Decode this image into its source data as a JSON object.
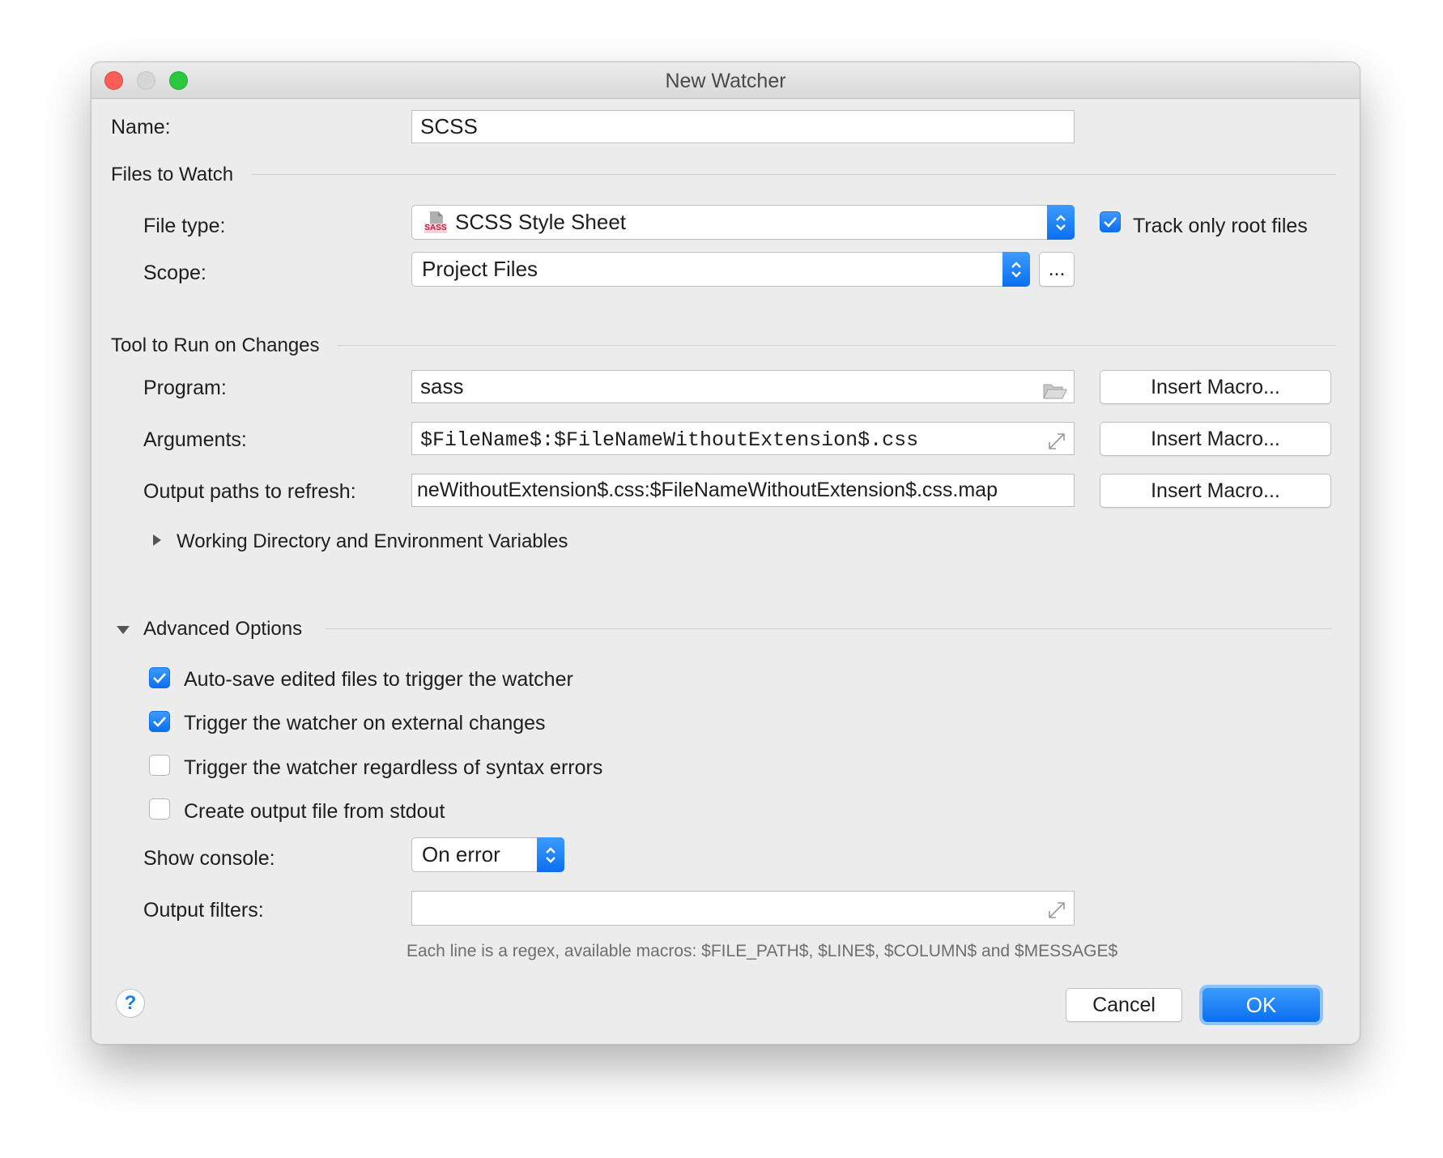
{
  "window": {
    "title": "New Watcher",
    "buttons": {
      "close": "close",
      "minimize": "minimize",
      "zoom": "zoom"
    }
  },
  "name": {
    "label": "Name:",
    "value": "SCSS"
  },
  "files_to_watch": {
    "section_title": "Files to Watch",
    "file_type_label": "File type:",
    "file_type_value": "SCSS Style Sheet",
    "file_type_icon_text": "SASS",
    "track_root_label": "Track only root files",
    "track_root_checked": true,
    "scope_label": "Scope:",
    "scope_value": "Project Files",
    "scope_more_label": "..."
  },
  "tool": {
    "section_title": "Tool to Run on Changes",
    "program_label": "Program:",
    "program_value": "sass",
    "arguments_label": "Arguments:",
    "arguments_value": "$FileName$:$FileNameWithoutExtension$.css",
    "output_paths_label": "Output paths to refresh:",
    "output_paths_value": "neWithoutExtension$.css:$FileNameWithoutExtension$.css.map",
    "insert_macro_label": "Insert Macro...",
    "working_dir_label": "Working Directory and Environment Variables"
  },
  "advanced": {
    "section_title": "Advanced Options",
    "options": [
      {
        "label": "Auto-save edited files to trigger the watcher",
        "checked": true
      },
      {
        "label": "Trigger the watcher on external changes",
        "checked": true
      },
      {
        "label": "Trigger the watcher regardless of syntax errors",
        "checked": false
      },
      {
        "label": "Create output file from stdout",
        "checked": false
      }
    ],
    "show_console_label": "Show console:",
    "show_console_value": "On error",
    "output_filters_label": "Output filters:",
    "output_filters_value": "",
    "hint": "Each line is a regex, available macros: $FILE_PATH$, $LINE$, $COLUMN$ and $MESSAGE$"
  },
  "footer": {
    "help_label": "?",
    "cancel_label": "Cancel",
    "ok_label": "OK"
  },
  "colors": {
    "accent": "#0a6ff0",
    "window_bg": "#ececec",
    "close": "#fc5f57",
    "zoom": "#2ac840"
  }
}
